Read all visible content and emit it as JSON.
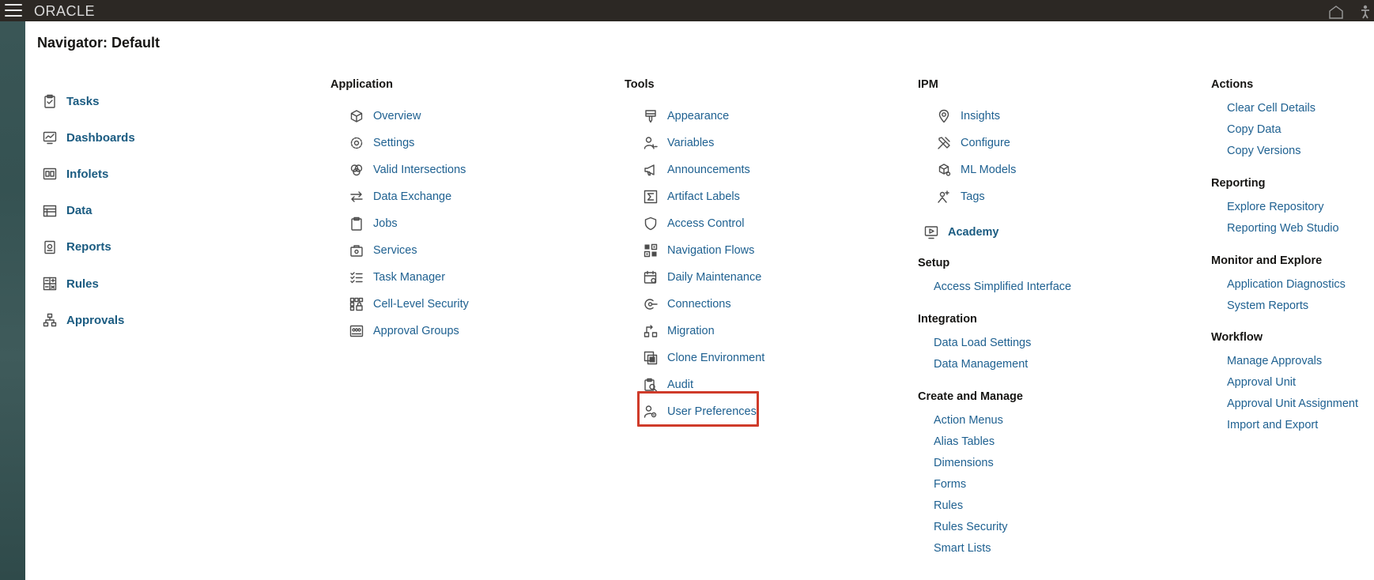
{
  "brand": {
    "logo_text": "ORACLE"
  },
  "navigator": {
    "title": "Navigator: Default"
  },
  "left_items": [
    {
      "label": "Tasks",
      "icon": "tasks-icon"
    },
    {
      "label": "Dashboards",
      "icon": "dashboards-icon"
    },
    {
      "label": "Infolets",
      "icon": "infolets-icon"
    },
    {
      "label": "Data",
      "icon": "data-icon"
    },
    {
      "label": "Reports",
      "icon": "reports-icon"
    },
    {
      "label": "Rules",
      "icon": "rules-icon"
    },
    {
      "label": "Approvals",
      "icon": "approvals-icon"
    }
  ],
  "application": {
    "heading": "Application",
    "items": [
      {
        "label": "Overview",
        "icon": "cube-icon"
      },
      {
        "label": "Settings",
        "icon": "gear-icon"
      },
      {
        "label": "Valid Intersections",
        "icon": "intersections-icon"
      },
      {
        "label": "Data Exchange",
        "icon": "exchange-arrows-icon"
      },
      {
        "label": "Jobs",
        "icon": "clipboard-icon"
      },
      {
        "label": "Services",
        "icon": "toolbox-icon"
      },
      {
        "label": "Task Manager",
        "icon": "checklist-icon"
      },
      {
        "label": "Cell-Level Security",
        "icon": "cell-security-icon"
      },
      {
        "label": "Approval Groups",
        "icon": "approval-groups-icon"
      }
    ]
  },
  "tools": {
    "heading": "Tools",
    "items": [
      {
        "label": "Appearance",
        "icon": "paint-brush-icon"
      },
      {
        "label": "Variables",
        "icon": "user-variable-icon"
      },
      {
        "label": "Announcements",
        "icon": "megaphone-icon"
      },
      {
        "label": "Artifact Labels",
        "icon": "sigma-icon"
      },
      {
        "label": "Access Control",
        "icon": "shield-icon"
      },
      {
        "label": "Navigation Flows",
        "icon": "navigation-grid-icon"
      },
      {
        "label": "Daily Maintenance",
        "icon": "calendar-gear-icon"
      },
      {
        "label": "Connections",
        "icon": "connection-plug-icon"
      },
      {
        "label": "Migration",
        "icon": "migration-icon"
      },
      {
        "label": "Clone Environment",
        "icon": "clone-icon"
      },
      {
        "label": "Audit",
        "icon": "audit-search-icon"
      },
      {
        "label": "User Preferences",
        "icon": "user-gear-icon"
      }
    ]
  },
  "ipm": {
    "heading": "IPM",
    "items": [
      {
        "label": "Insights",
        "icon": "lightbulb-pin-icon"
      },
      {
        "label": "Configure",
        "icon": "tools-icon"
      },
      {
        "label": "ML Models",
        "icon": "ml-models-icon"
      },
      {
        "label": "Tags",
        "icon": "sparkle-user-icon"
      }
    ]
  },
  "academy": {
    "label": "Academy",
    "icon": "video-monitor-icon"
  },
  "setup": {
    "heading": "Setup",
    "items": [
      "Access Simplified Interface"
    ]
  },
  "integration": {
    "heading": "Integration",
    "items": [
      "Data Load Settings",
      "Data Management"
    ]
  },
  "create_manage": {
    "heading": "Create and Manage",
    "items": [
      "Action Menus",
      "Alias Tables",
      "Dimensions",
      "Forms",
      "Rules",
      "Rules Security",
      "Smart Lists"
    ]
  },
  "actions": {
    "heading": "Actions",
    "items": [
      "Clear Cell Details",
      "Copy Data",
      "Copy Versions"
    ]
  },
  "reporting": {
    "heading": "Reporting",
    "items": [
      "Explore Repository",
      "Reporting Web Studio"
    ]
  },
  "monitor": {
    "heading": "Monitor and Explore",
    "items": [
      "Application Diagnostics",
      "System Reports"
    ]
  },
  "workflow": {
    "heading": "Workflow",
    "items": [
      "Manage Approvals",
      "Approval Unit",
      "Approval Unit Assignment",
      "Import and Export"
    ]
  }
}
